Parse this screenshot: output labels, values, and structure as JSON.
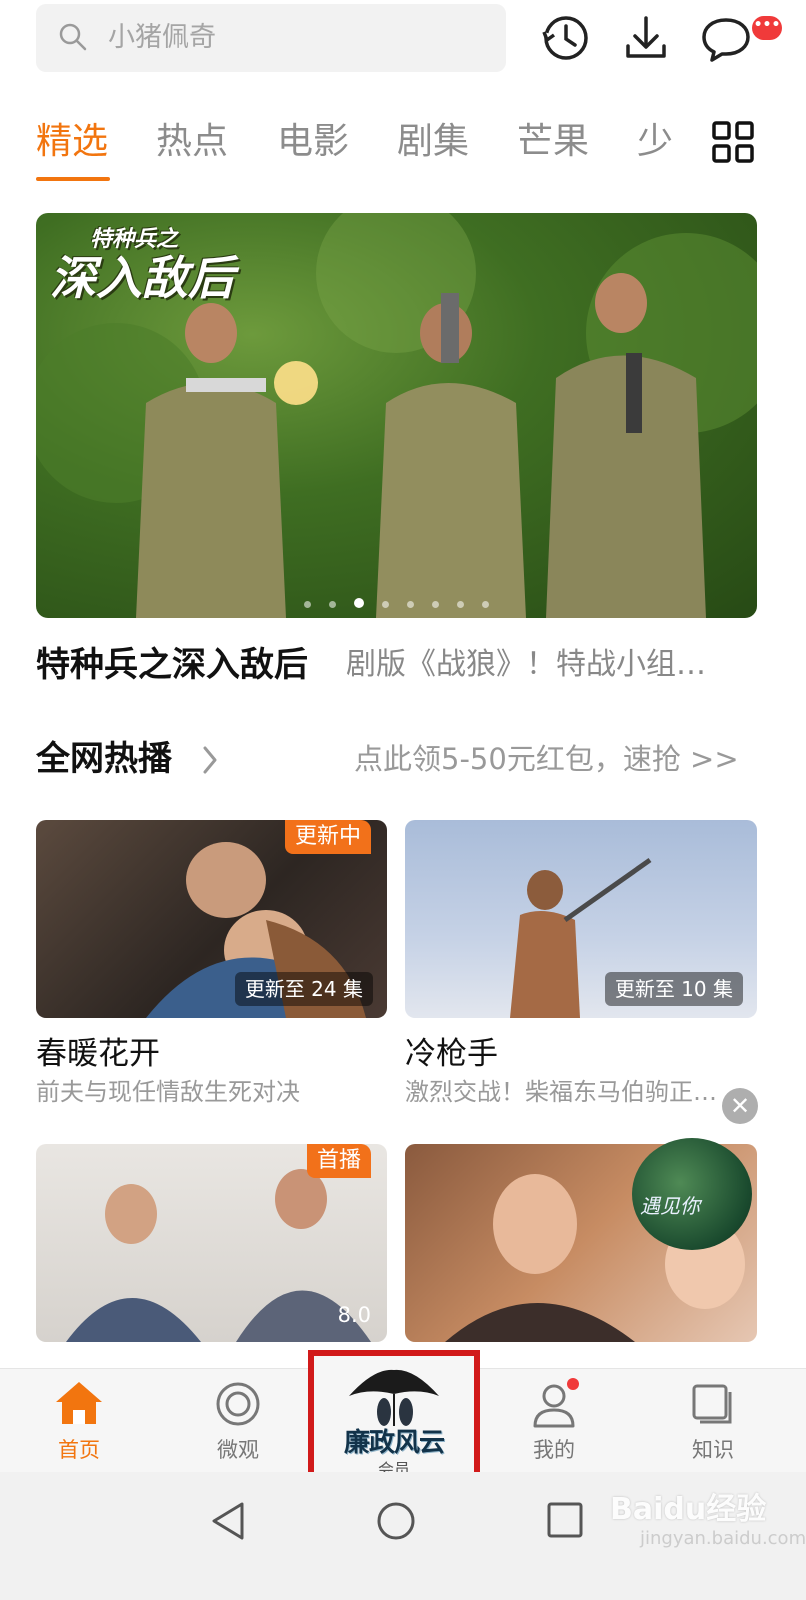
{
  "search": {
    "placeholder": "小猪佩奇"
  },
  "header": {
    "message_badge": "•••"
  },
  "tabs": [
    {
      "label": "精选",
      "active": true
    },
    {
      "label": "热点"
    },
    {
      "label": "电影"
    },
    {
      "label": "剧集"
    },
    {
      "label": "芒果"
    },
    {
      "label": "少"
    }
  ],
  "hero": {
    "logo_small": "特种兵之",
    "logo_large": "深入敌后",
    "title": "特种兵之深入敌后",
    "desc": "剧版《战狼》！特战小组…",
    "page_count": 8,
    "active_page": 3
  },
  "section": {
    "title": "全网热播",
    "promo": "点此领5-50元红包，速抢 >>"
  },
  "cards": [
    {
      "title": "春暖花开",
      "sub": "前夫与现任情敌生死对决",
      "tag": "更新中",
      "ep": "更新至 24 集"
    },
    {
      "title": "冷枪手",
      "sub": "激烈交战！柴福东马伯驹正…",
      "ep": "更新至 10 集"
    },
    {
      "tag": "首播",
      "rating": "8.0"
    },
    {}
  ],
  "floater": {
    "text": "遇见你"
  },
  "nav": {
    "home": "首页",
    "weiguan": "微观",
    "promo_title": "廉政风云",
    "promo_sub": "会员",
    "mine": "我的",
    "knowledge": "知识"
  },
  "watermark": {
    "main": "Baidu经验",
    "sub": "jingyan.baidu.com"
  },
  "colors": {
    "accent": "#f2750f",
    "badge": "#f03a3a",
    "highlight_box": "#d11a1a"
  }
}
